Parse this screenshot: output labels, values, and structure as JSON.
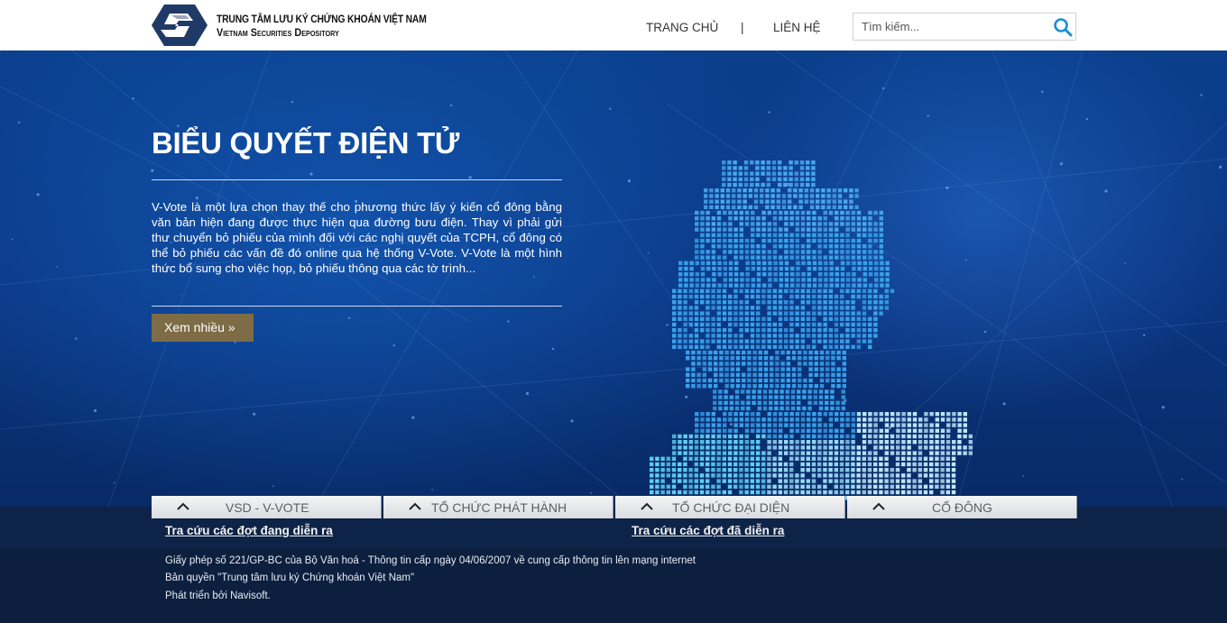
{
  "header": {
    "brand_line1": "TRUNG TÂM LƯU KÝ CHỨNG KHOÁN VIỆT NAM",
    "brand_line2": "Vietnam Securities Depository",
    "nav": {
      "home": "TRANG CHỦ",
      "separator": "|",
      "contact": "LIÊN HỆ"
    },
    "search": {
      "placeholder": "Tìm kiếm..."
    }
  },
  "hero": {
    "title": "BIỂU QUYẾT ĐIỆN TỬ",
    "description": "V-Vote là một lựa chọn thay thế cho phương thức lấy ý kiến cổ đông bằng văn bản hiện đang được thực hiện qua đường bưu điện. Thay vì phải gửi thư chuyển bỏ phiếu của mình đối với các nghị quyết của TCPH, cổ đông có thể bỏ phiếu các vấn đề đó online qua hệ thống V-Vote. V-Vote là một hình thức bổ sung cho việc họp, bỏ phiếu thông qua các tờ trình...",
    "more_button": "Xem nhiều »"
  },
  "tabs": [
    {
      "label": "VSD - V-VOTE"
    },
    {
      "label": "TỔ CHỨC PHÁT HÀNH"
    },
    {
      "label": "TỔ CHỨC ĐẠI DIỆN"
    },
    {
      "label": "CỔ ĐÔNG"
    }
  ],
  "links": {
    "ongoing": "Tra cứu các đợt đang diễn ra",
    "past": "Tra cứu các đợt đã diễn ra"
  },
  "footer": {
    "license": "Giấy phép số 221/GP-BC của Bộ Văn hoá - Thông tin cấp ngày 04/06/2007 về cung cấp thông tin lên mạng internet",
    "copyright": "Bản quyền \"Trung tâm lưu ký Chứng khoán Việt Nam\"",
    "developer": "Phát triển bởi Navisoft."
  },
  "colors": {
    "hero_blue": "#0b3a86",
    "button_brown": "#7e6c47",
    "footer_navy": "#0c1f3f",
    "map_light": "#7fd0f0"
  },
  "icons": [
    "vsd-logo",
    "search-icon",
    "chevron-up-icon"
  ]
}
